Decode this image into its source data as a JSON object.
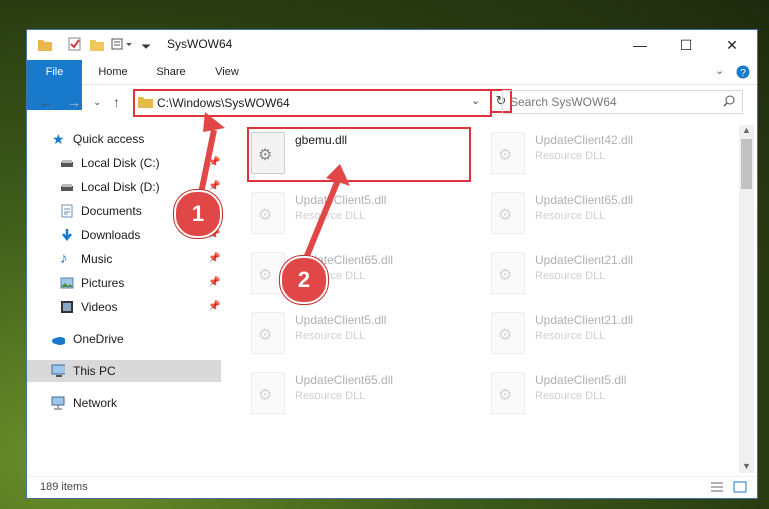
{
  "window": {
    "title": "SysWOW64",
    "controls": {
      "minimize": "—",
      "maximize": "☐",
      "close": "✕"
    }
  },
  "ribbon": {
    "tabs": [
      {
        "label": "File"
      },
      {
        "label": "Home"
      },
      {
        "label": "Share"
      },
      {
        "label": "View"
      }
    ]
  },
  "navigation": {
    "address": "C:\\Windows\\SysWOW64",
    "search_placeholder": "Search SysWOW64"
  },
  "sidebar": {
    "items": [
      {
        "label": "Quick access",
        "icon": "star-icon"
      },
      {
        "label": "Local Disk (C:)",
        "icon": "drive-icon"
      },
      {
        "label": "Local Disk (D:)",
        "icon": "drive-icon"
      },
      {
        "label": "Documents",
        "icon": "documents-icon"
      },
      {
        "label": "Downloads",
        "icon": "download-icon"
      },
      {
        "label": "Music",
        "icon": "music-icon"
      },
      {
        "label": "Pictures",
        "icon": "pictures-icon"
      },
      {
        "label": "Videos",
        "icon": "videos-icon"
      },
      {
        "label": "OneDrive",
        "icon": "cloud-icon"
      },
      {
        "label": "This PC",
        "icon": "computer-icon"
      },
      {
        "label": "Network",
        "icon": "network-icon"
      }
    ]
  },
  "files": [
    {
      "name": "gbemu.dll",
      "type": ""
    },
    {
      "name": "UpdateClient42.dll",
      "type": "Resource DLL"
    },
    {
      "name": "UpdateClient5.dll",
      "type": "Resource DLL"
    },
    {
      "name": "UpdateClient65.dll",
      "type": "Resource DLL"
    },
    {
      "name": "UpdateClient65.dll",
      "type": "Resource DLL"
    },
    {
      "name": "UpdateClient21.dll",
      "type": "Resource DLL"
    },
    {
      "name": "UpdateClient5.dll",
      "type": "Resource DLL"
    },
    {
      "name": "UpdateClient21.dll",
      "type": "Resource DLL"
    },
    {
      "name": "UpdateClient65.dll",
      "type": "Resource DLL"
    },
    {
      "name": "UpdateClient5.dll",
      "type": "Resource DLL"
    }
  ],
  "status": {
    "item_count": "189 items"
  },
  "annotations": {
    "step1": "1",
    "step2": "2"
  },
  "colors": {
    "accent": "#1979ca",
    "highlight": "#e0323b"
  }
}
